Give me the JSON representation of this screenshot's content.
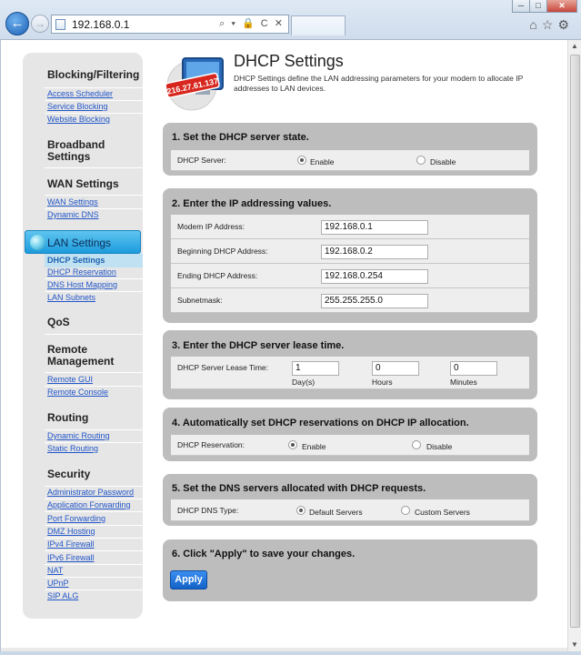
{
  "browser": {
    "url": "192.168.0.1",
    "address_tools": "⌕ ▾ 🔒 C ✕",
    "win_minimize": "─",
    "win_maximize": "□",
    "win_close": "✕",
    "icons": [
      "home-icon",
      "star-icon",
      "gear-icon"
    ]
  },
  "sidebar": {
    "groups": [
      {
        "heading": "Blocking/Filtering",
        "links": [
          "Access Scheduler",
          "Service Blocking",
          "Website Blocking"
        ]
      },
      {
        "heading": "Broadband\nSettings",
        "links": []
      },
      {
        "heading": "WAN Settings",
        "links": [
          "WAN Settings",
          "Dynamic DNS"
        ]
      },
      {
        "heading": "LAN Settings",
        "links": [
          "DHCP Settings",
          "DHCP Reservation",
          "DNS Host Mapping",
          "LAN Subnets"
        ]
      },
      {
        "heading": "QoS",
        "links": []
      },
      {
        "heading": "Remote\nManagement",
        "links": [
          "Remote GUI",
          "Remote Console"
        ]
      },
      {
        "heading": "Routing",
        "links": [
          "Dynamic Routing",
          "Static Routing"
        ]
      },
      {
        "heading": "Security",
        "links": [
          "Administrator Password",
          "Application Forwarding",
          "Port Forwarding",
          "DMZ Hosting",
          "IPv4 Firewall",
          "IPv6 Firewall",
          "NAT",
          "UPnP",
          "SIP ALG"
        ]
      }
    ]
  },
  "logo_text": "216.27.61.137",
  "page": {
    "title": "DHCP Settings",
    "description": "DHCP Settings define the LAN addressing parameters for your modem to allocate IP addresses to LAN devices."
  },
  "sections": {
    "s1": {
      "title": "1. Set the DHCP server state.",
      "label": "DHCP Server:",
      "opt_on": "Enable",
      "opt_off": "Disable",
      "selected": "Enable"
    },
    "s2": {
      "title": "2. Enter the IP addressing values.",
      "rows": [
        {
          "label": "Modem IP Address:",
          "value": "192.168.0.1"
        },
        {
          "label": "Beginning DHCP Address:",
          "value": "192.168.0.2"
        },
        {
          "label": "Ending DHCP Address:",
          "value": "192.168.0.254"
        },
        {
          "label": "Subnetmask:",
          "value": "255.255.255.0"
        }
      ]
    },
    "s3": {
      "title": "3. Enter the DHCP server lease time.",
      "label": "DHCP Server Lease Time:",
      "days": "1",
      "hours": "0",
      "minutes": "0",
      "days_label": "Day(s)",
      "hours_label": "Hours",
      "minutes_label": "Minutes"
    },
    "s4": {
      "title": "4. Automatically set DHCP reservations on DHCP IP allocation.",
      "label": "DHCP Reservation:",
      "opt_on": "Enable",
      "opt_off": "Disable",
      "selected": "Enable"
    },
    "s5": {
      "title": "5. Set the DNS servers allocated with DHCP requests.",
      "label": "DHCP DNS Type:",
      "opt_a": "Default Servers",
      "opt_b": "Custom Servers",
      "selected": "Default Servers"
    },
    "s6": {
      "title": "6. Click \"Apply\" to save your changes.",
      "apply_label": "Apply"
    }
  }
}
